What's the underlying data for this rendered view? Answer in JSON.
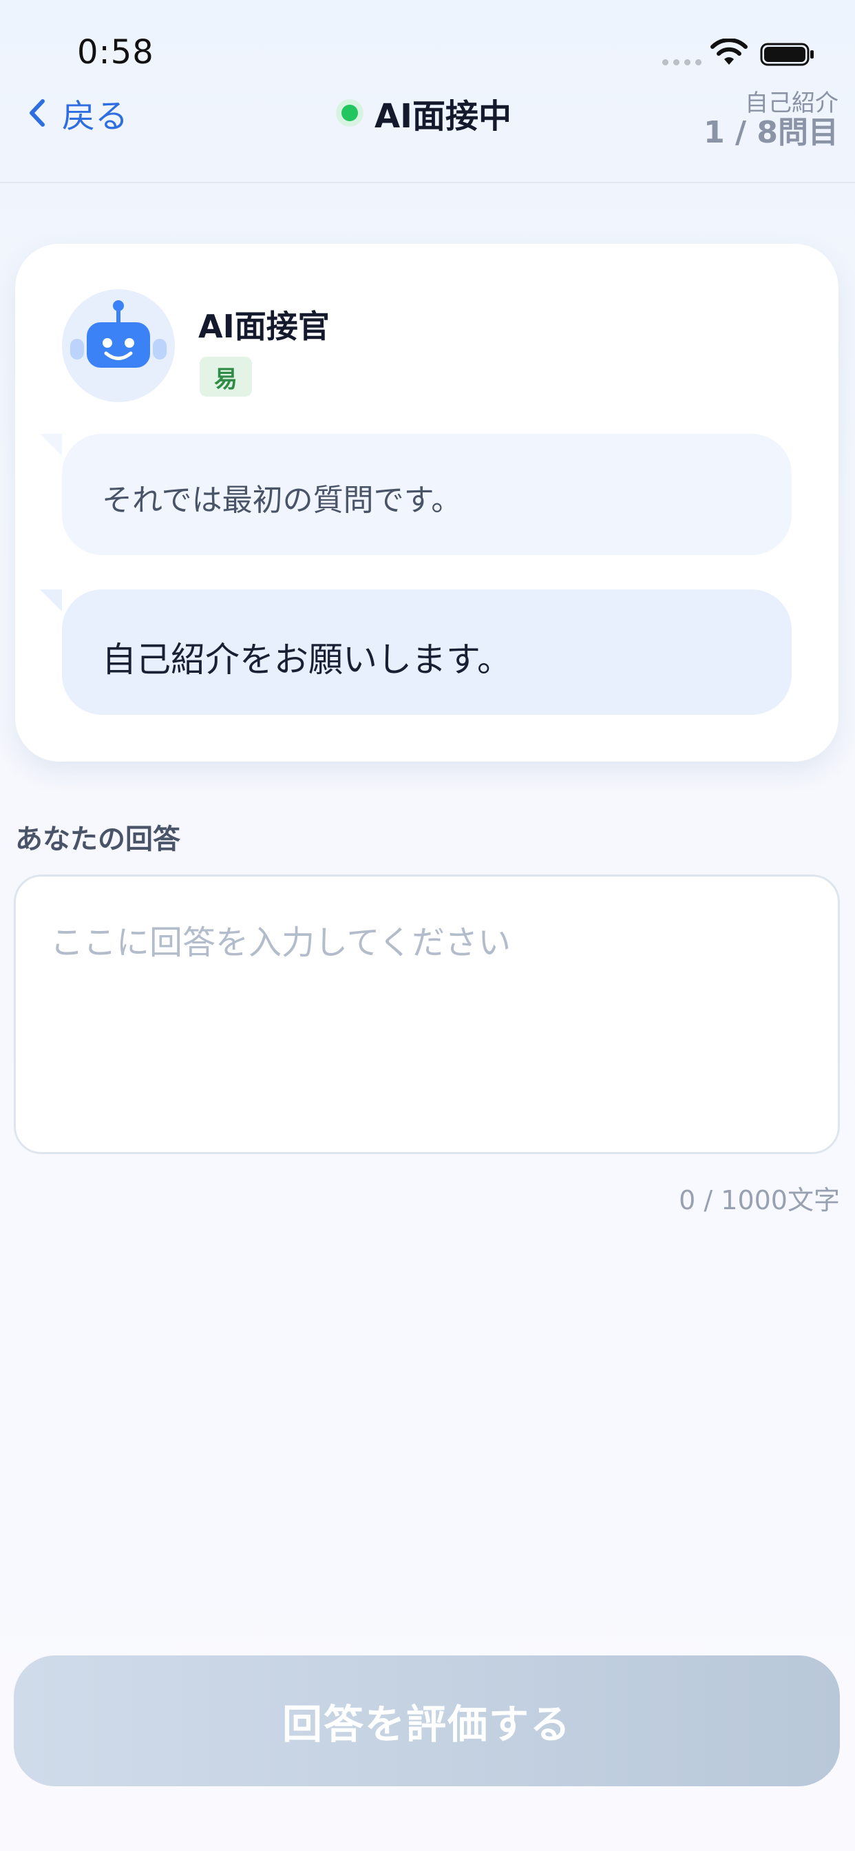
{
  "status_bar": {
    "time": "0:58"
  },
  "nav": {
    "back_label": "戻る",
    "title": "AI面接中",
    "category": "自己紹介",
    "progress": "1 / 8問目",
    "live_color": "#22c55e",
    "back_icon": "chevron-left-icon"
  },
  "interviewer": {
    "name": "AI面接官",
    "difficulty": "易",
    "avatar_icon": "robot-icon"
  },
  "messages": [
    {
      "text": "それでは最初の質問です。"
    },
    {
      "text": "自己紹介をお願いします。"
    }
  ],
  "answer": {
    "label": "あなたの回答",
    "placeholder": "ここに回答を入力してください",
    "value": "",
    "char_count": "0 / 1000文字"
  },
  "submit": {
    "label": "回答を評価する",
    "disabled": true
  },
  "colors": {
    "accent": "#2f6ee0",
    "difficulty_badge_bg": "#e3f4e7",
    "difficulty_badge_text": "#2f8c46"
  }
}
